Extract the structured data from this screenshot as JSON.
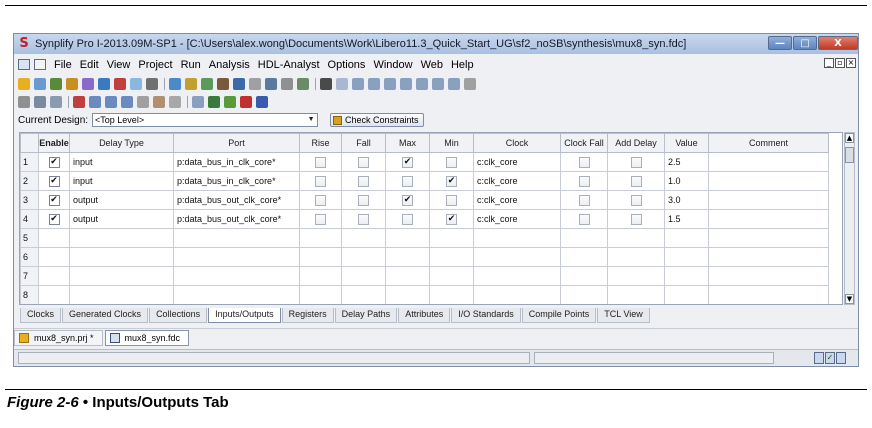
{
  "window": {
    "title": "Synplify Pro I-2013.09M-SP1 - [C:\\Users\\alex.wong\\Documents\\Work\\Libero11.3_Quick_Start_UG\\sf2_noSB\\synthesis\\mux8_syn.fdc]",
    "app_icon": "S",
    "buttons": {
      "minimize": "—",
      "maximize": "□",
      "close": "X"
    }
  },
  "menu": {
    "items": [
      "File",
      "Edit",
      "View",
      "Project",
      "Run",
      "Analysis",
      "HDL-Analyst",
      "Options",
      "Window",
      "Web",
      "Help"
    ]
  },
  "design": {
    "label": "Current Design:",
    "selected": "<Top Level>",
    "check_button": "Check Constraints"
  },
  "grid": {
    "columns": [
      "",
      "Enable",
      "Delay Type",
      "Port",
      "Rise",
      "Fall",
      "Max",
      "Min",
      "Clock",
      "Clock Fall",
      "Add Delay",
      "Value",
      "Comment"
    ],
    "rows": [
      {
        "num": "1",
        "enable": true,
        "delay_type": "input",
        "port": "p:data_bus_in_clk_core*",
        "rise": false,
        "fall": false,
        "max": true,
        "min": false,
        "clock": "c:clk_core",
        "clock_fall": false,
        "add_delay": false,
        "value": "2.5",
        "comment": ""
      },
      {
        "num": "2",
        "enable": true,
        "delay_type": "input",
        "port": "p:data_bus_in_clk_core*",
        "rise": false,
        "fall": false,
        "max": false,
        "min": true,
        "clock": "c:clk_core",
        "clock_fall": false,
        "add_delay": false,
        "value": "1.0",
        "comment": ""
      },
      {
        "num": "3",
        "enable": true,
        "delay_type": "output",
        "port": "p:data_bus_out_clk_core*",
        "rise": false,
        "fall": false,
        "max": true,
        "min": false,
        "clock": "c:clk_core",
        "clock_fall": false,
        "add_delay": false,
        "value": "3.0",
        "comment": ""
      },
      {
        "num": "4",
        "enable": true,
        "delay_type": "output",
        "port": "p:data_bus_out_clk_core*",
        "rise": false,
        "fall": false,
        "max": false,
        "min": true,
        "clock": "c:clk_core",
        "clock_fall": false,
        "add_delay": false,
        "value": "1.5",
        "comment": ""
      },
      {
        "num": "5"
      },
      {
        "num": "6"
      },
      {
        "num": "7"
      },
      {
        "num": "8"
      }
    ]
  },
  "tabs": {
    "items": [
      "Clocks",
      "Generated Clocks",
      "Collections",
      "Inputs/Outputs",
      "Registers",
      "Delay Paths",
      "Attributes",
      "I/O Standards",
      "Compile Points",
      "TCL View"
    ],
    "active": "Inputs/Outputs"
  },
  "documents": [
    "mux8_syn.prj *",
    "mux8_syn.fdc"
  ],
  "caption": {
    "figure": "Figure 2-6",
    "text": " • Inputs/Outputs Tab"
  },
  "icons": [
    "synplify-icon",
    "open-icon",
    "save-icon",
    "run-icon",
    "find-icon",
    "zoom-in-icon",
    "zoom-out-icon",
    "undo-icon",
    "redo-icon",
    "check-icon"
  ]
}
